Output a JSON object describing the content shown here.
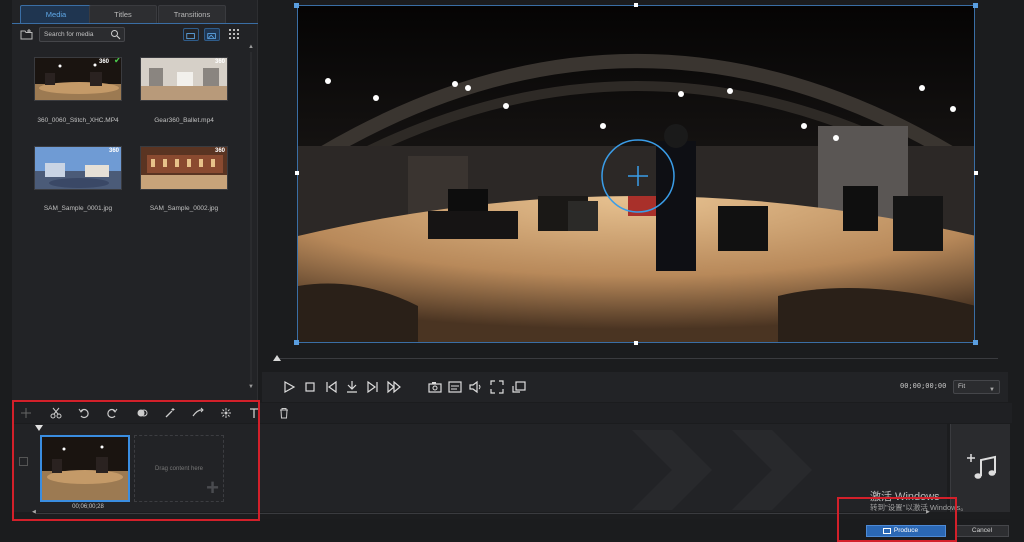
{
  "media_panel": {
    "tabs": [
      {
        "label": "Media",
        "active": true
      },
      {
        "label": "Titles",
        "active": false
      },
      {
        "label": "Transitions",
        "active": false
      }
    ],
    "search": {
      "placeholder": "Search for media"
    },
    "items": [
      {
        "name": "360_0060_Stitch_XHC.MP4",
        "badge": "360",
        "checked": true
      },
      {
        "name": "Gear360_Ballet.mp4",
        "badge": "360",
        "checked": false
      },
      {
        "name": "SAM_Sample_0001.jpg",
        "badge": "360",
        "checked": false
      },
      {
        "name": "SAM_Sample_0002.jpg",
        "badge": "360",
        "checked": false
      }
    ]
  },
  "preview": {
    "timecode": "00;00;00;00",
    "zoom": "Fit"
  },
  "timeline": {
    "clip_duration": "00;06;00;28",
    "drop_hint": "Drag content here"
  },
  "watermark": {
    "line1": "激活 Windows",
    "line2": "转到\"设置\"以激活 Windows。"
  },
  "footer": {
    "produce_label": "Produce",
    "cancel_label": "Cancel"
  },
  "colors": {
    "accent": "#3a8de0",
    "produce": "#2b68b5",
    "highlight_box": "#d3202a"
  }
}
